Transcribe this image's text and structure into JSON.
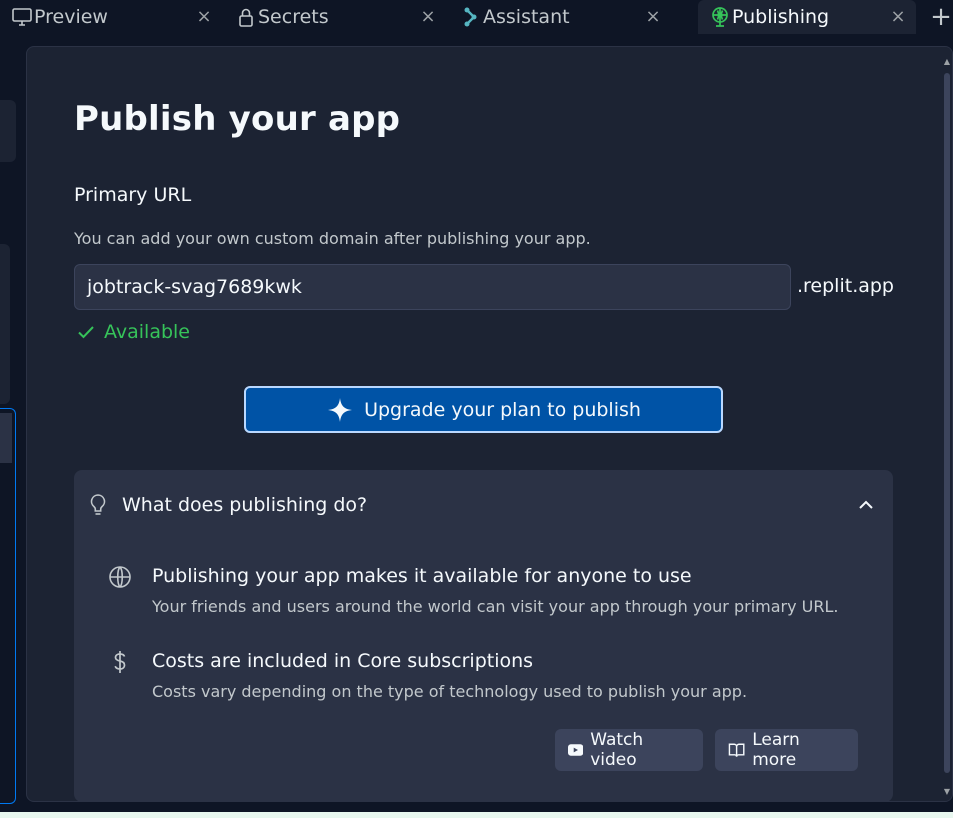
{
  "tabs": [
    {
      "label": "Preview",
      "icon": "monitor-icon"
    },
    {
      "label": "Secrets",
      "icon": "lock-icon"
    },
    {
      "label": "Assistant",
      "icon": "assistant-icon"
    },
    {
      "label": "Publishing",
      "icon": "publishing-icon",
      "active": true
    }
  ],
  "new_tab_glyph": "+",
  "close_glyph": "×",
  "publish": {
    "title": "Publish your app",
    "primary_url_label": "Primary URL",
    "help_text": "You can add your own custom domain after publishing your app.",
    "url_value": "jobtrack-svag7689kwk",
    "url_suffix": ".replit.app",
    "availability": "Available",
    "upgrade_button": "Upgrade your plan to publish"
  },
  "info": {
    "heading": "What does publishing do?",
    "items": [
      {
        "icon": "globe-icon",
        "title": "Publishing your app makes it available for anyone to use",
        "description": "Your friends and users around the world can visit your app through your primary URL."
      },
      {
        "icon": "dollar-icon",
        "title": "Costs are included in Core subscriptions",
        "description": "Costs vary depending on the type of technology used to publish your app."
      }
    ],
    "watch_video": "Watch video",
    "learn_more": "Learn more"
  },
  "colors": {
    "background": "#0e1525",
    "panel": "#1c2333",
    "surface": "#2b3245",
    "accent": "#0053a6",
    "success": "#36c35a"
  }
}
